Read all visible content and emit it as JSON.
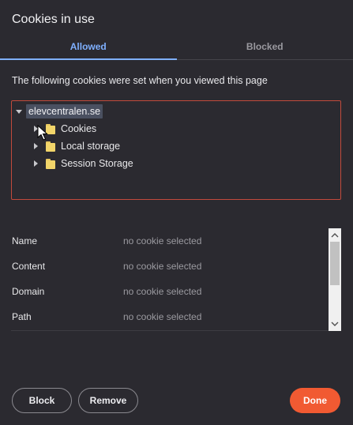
{
  "dialog": {
    "title": "Cookies in use"
  },
  "tabs": [
    {
      "label": "Allowed",
      "active": true
    },
    {
      "label": "Blocked",
      "active": false
    }
  ],
  "description": "The following cookies were set when you viewed this page",
  "tree": {
    "root": {
      "label": "elevcentralen.se",
      "expanded": true
    },
    "children": [
      {
        "label": "Cookies",
        "icon": "folder-icon",
        "expanded": false
      },
      {
        "label": "Local storage",
        "icon": "folder-icon",
        "expanded": false
      },
      {
        "label": "Session Storage",
        "icon": "folder-icon",
        "expanded": false
      }
    ]
  },
  "details": [
    {
      "key": "Name",
      "value": "no cookie selected"
    },
    {
      "key": "Content",
      "value": "no cookie selected"
    },
    {
      "key": "Domain",
      "value": "no cookie selected"
    },
    {
      "key": "Path",
      "value": "no cookie selected"
    }
  ],
  "buttons": {
    "block": "Block",
    "remove": "Remove",
    "done": "Done"
  },
  "colors": {
    "background": "#2b2a30",
    "accent_tab": "#7fb0ff",
    "tree_border": "#c24a3c",
    "done_button": "#f15a32",
    "folder": "#f2d56a"
  }
}
